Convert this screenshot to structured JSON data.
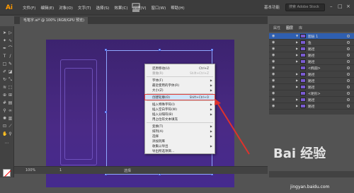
{
  "app": {
    "logo": "Ai",
    "workspace": "基本功能",
    "search_placeholder": "搜索 Adobe Stock"
  },
  "menu": [
    "文件(F)",
    "编辑(E)",
    "对象(O)",
    "文字(T)",
    "选择(S)",
    "效果(C)",
    "视图(V)",
    "窗口(W)",
    "帮助(H)"
  ],
  "document": {
    "tab_title": "毛笔字.ai* @ 100% (RGB/GPU 预览)"
  },
  "context_menu": {
    "items": [
      {
        "label": "还原移动(U)",
        "shortcut": "Ctrl+Z",
        "disabled": false,
        "submenu": false
      },
      {
        "label": "重做(R)",
        "shortcut": "Shift+Ctrl+Z",
        "disabled": true,
        "submenu": false
      },
      {
        "label": "字体(F)",
        "shortcut": "",
        "disabled": false,
        "submenu": true
      },
      {
        "label": "最近使用的字体(R)",
        "shortcut": "",
        "disabled": false,
        "submenu": true
      },
      {
        "label": "大小(Z)",
        "shortcut": "",
        "disabled": false,
        "submenu": true
      },
      {
        "label": "创建轮廓(O)",
        "shortcut": "Shift+Ctrl+O",
        "disabled": false,
        "submenu": false,
        "highlight": true
      },
      {
        "label": "插入特殊字符(I)",
        "shortcut": "",
        "disabled": false,
        "submenu": true
      },
      {
        "label": "插入空白字符(W)",
        "shortcut": "",
        "disabled": false,
        "submenu": true
      },
      {
        "label": "插入分隔符(B)",
        "shortcut": "",
        "disabled": false,
        "submenu": true
      },
      {
        "label": "用占位符文本填充",
        "shortcut": "",
        "disabled": false,
        "submenu": false
      },
      {
        "label": "变换(T)",
        "shortcut": "",
        "disabled": false,
        "submenu": true
      },
      {
        "label": "排列(A)",
        "shortcut": "",
        "disabled": false,
        "submenu": true
      },
      {
        "label": "选择",
        "shortcut": "",
        "disabled": false,
        "submenu": true
      },
      {
        "label": "添加到库",
        "shortcut": "",
        "disabled": false,
        "submenu": false
      },
      {
        "label": "收集以导出",
        "shortcut": "",
        "disabled": false,
        "submenu": true
      },
      {
        "label": "导出所选项目...",
        "shortcut": "",
        "disabled": false,
        "submenu": false
      }
    ]
  },
  "status": {
    "zoom": "100%",
    "page": "1",
    "tool": "选择"
  },
  "panels": {
    "tabs": [
      "属性",
      "图层",
      "库"
    ],
    "active_tab": "图层",
    "layers": [
      {
        "name": "图层 1",
        "visible": true,
        "selected": true
      },
      {
        "name": "鱼",
        "visible": true,
        "selected": false
      },
      {
        "name": "路径",
        "visible": true,
        "selected": false
      },
      {
        "name": "路径",
        "visible": true,
        "selected": false
      },
      {
        "name": "路径",
        "visible": true,
        "selected": false
      },
      {
        "name": "<椭圆>",
        "visible": true,
        "selected": false
      },
      {
        "name": "路径",
        "visible": true,
        "selected": false
      },
      {
        "name": "路径",
        "visible": true,
        "selected": false
      },
      {
        "name": "路径",
        "visible": true,
        "selected": false
      },
      {
        "name": "<矩形>",
        "visible": true,
        "selected": false
      },
      {
        "name": "路径",
        "visible": true,
        "selected": false
      },
      {
        "name": "路径",
        "visible": true,
        "selected": false
      }
    ]
  },
  "watermark": {
    "brand": "Bai 经验",
    "url": "jingyan.baidu.com"
  },
  "colors": {
    "highlight_outline": "#e0403a",
    "artboard": "#4a2a86",
    "accent_logo": "#ff9a00"
  }
}
